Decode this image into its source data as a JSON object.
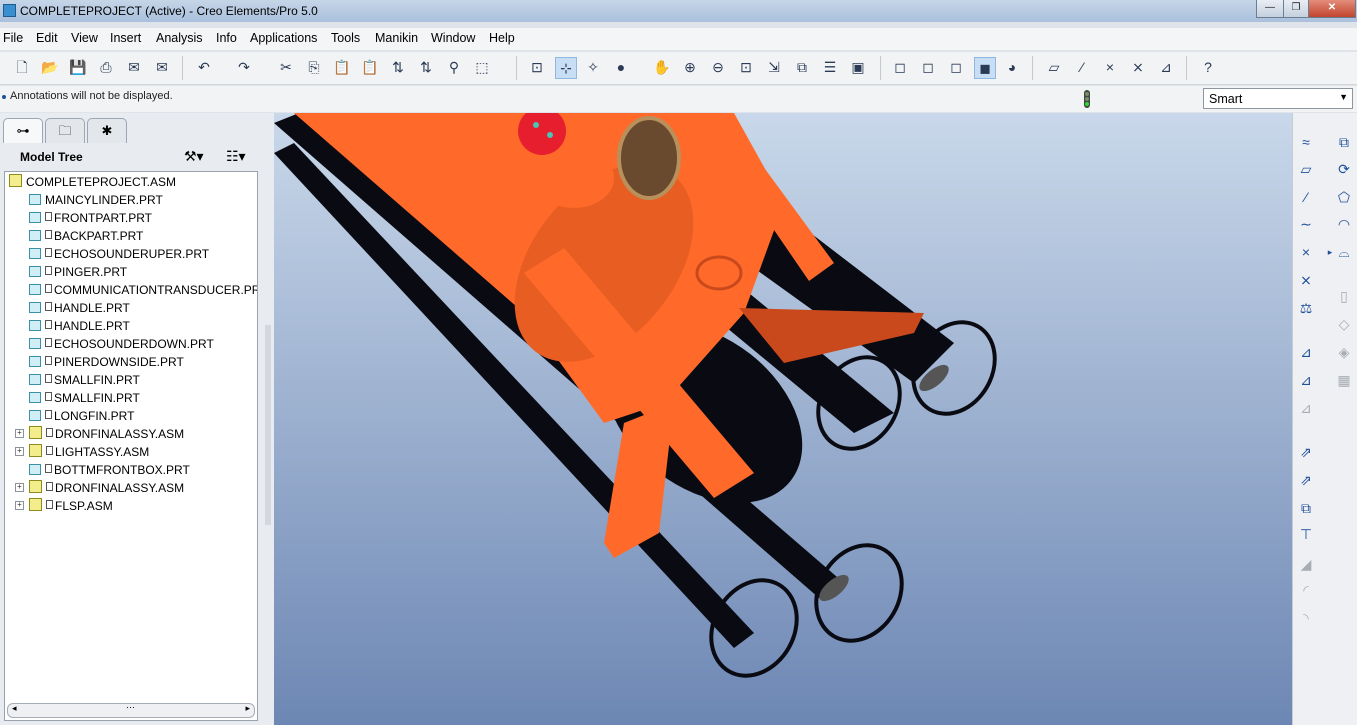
{
  "window": {
    "title": "COMPLETEPROJECT (Active) - Creo Elements/Pro 5.0"
  },
  "menubar": {
    "items": [
      "File",
      "Edit",
      "View",
      "Insert",
      "Analysis",
      "Info",
      "Applications",
      "Tools",
      "Manikin",
      "Window",
      "Help"
    ]
  },
  "message": {
    "text": "Annotations will not be displayed."
  },
  "filter": {
    "value": "Smart"
  },
  "model_tree": {
    "title": "Model Tree",
    "root": "COMPLETEPROJECT.ASM",
    "items": [
      "MAINCYLINDER.PRT",
      "FRONTPART.PRT",
      "BACKPART.PRT",
      "ECHOSOUNDERUPER.PRT",
      "PINGER.PRT",
      "COMMUNICATIONTRANSDUCER.PRT",
      "HANDLE.PRT",
      "HANDLE.PRT",
      "ECHOSOUNDERDOWN.PRT",
      "PINERDOWNSIDE.PRT",
      "SMALLFIN.PRT",
      "SMALLFIN.PRT",
      "LONGFIN.PRT",
      "DRONFINALASSY.ASM",
      "LIGHTASSY.ASM",
      "BOTTMFRONTBOX.PRT",
      "DRONFINALASSY.ASM",
      "FLSP.ASM"
    ]
  },
  "colors": {
    "model_orange": "#ff6a2a",
    "model_dark": "#0a0a12",
    "viewport_top": "#c9d8ea",
    "viewport_bottom": "#6d87b4"
  }
}
